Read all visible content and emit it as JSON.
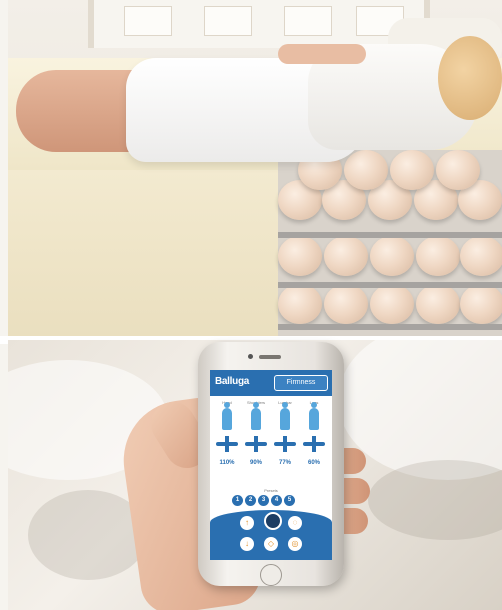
{
  "app": {
    "brand": "Balluga",
    "mode_label": "Firmness",
    "zones": [
      {
        "label": "Head",
        "value": "110%"
      },
      {
        "label": "Shoulders",
        "value": "90%"
      },
      {
        "label": "Lumbar",
        "value": "77%"
      },
      {
        "label": "Legs",
        "value": "60%"
      }
    ],
    "presets_title": "Presets",
    "presets": [
      "1",
      "2",
      "3",
      "4",
      "5"
    ],
    "controls": [
      "firmness-up-icon",
      "sleep-icon",
      "cushion-icon",
      "firmness-down-icon",
      "mode-icon",
      "massage-icon"
    ]
  },
  "colors": {
    "app_blue": "#2a6fb0",
    "figure_blue": "#56a6dc",
    "control_accent": "#e0932f"
  }
}
